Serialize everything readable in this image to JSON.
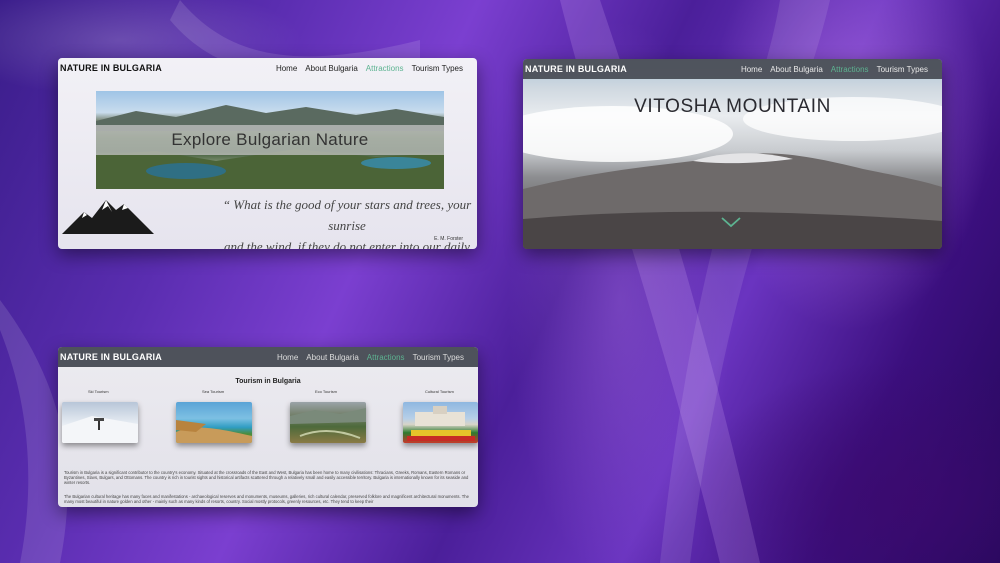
{
  "windows": [
    {
      "brand": "NATURE IN BULGARIA",
      "menu": [
        "Home",
        "About Bulgaria",
        "Attractions",
        "Tourism Types"
      ],
      "active_menu": "Attractions",
      "banner_title": "Explore Bulgarian Nature",
      "quote_line1": "“ What is the good of your stars and trees, your sunrise",
      "quote_line2": "and the wind, if they do not enter into our daily lives?”",
      "quote_author": "E. M. Forster"
    },
    {
      "brand": "NATURE IN BULGARIA",
      "menu": [
        "Home",
        "About Bulgaria",
        "Attractions",
        "Tourism Types"
      ],
      "active_menu": "Attractions",
      "hero_title": "VITOSHA MOUNTAIN",
      "scroll_icon": "chevron-down-icon"
    },
    {
      "brand": "NATURE IN BULGARIA",
      "menu": [
        "Home",
        "About Bulgaria",
        "Attractions",
        "Tourism Types"
      ],
      "active_menu": "Attractions",
      "section_title": "Tourism in Bulgaria",
      "cards": [
        {
          "label": "Ski Tourism"
        },
        {
          "label": "Sea Tourism"
        },
        {
          "label": "Eco Tourism"
        },
        {
          "label": "Cultural Tourism"
        }
      ],
      "paragraph1": "Tourism in Bulgaria is a significant contributor to the country's economy. Situated at the crossroads of the East and West, Bulgaria has been home to many civilisations: Thracians, Greeks, Romans, Eastern Romans or Byzantines, Slavs, Bulgars, and Ottomans. The country is rich in tourist sights and historical artifacts scattered through a relatively small and easily accessible territory. Bulgaria is internationally known for its seaside and winter resorts.",
      "paragraph2": "The Bulgarian cultural heritage has many faces and manifestations - archaeological reserves and monuments, museums, galleries, rich cultural calendar, preserved folklore and magnificent architectural monuments. The many most beautiful in nature golden and other - mainly such as many kinds of resorts, country. Social mostly protocols, greenly resources, etc. They tend to keep their"
    }
  ],
  "colors": {
    "accent": "#5db391",
    "nav_dark": "#464a52"
  }
}
